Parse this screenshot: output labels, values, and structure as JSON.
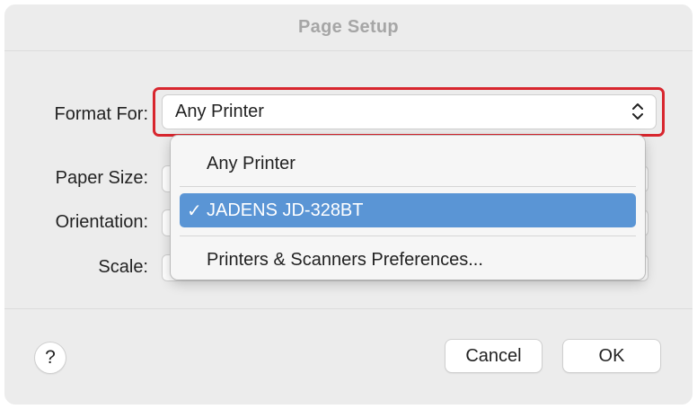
{
  "dialog": {
    "title": "Page Setup",
    "help_label": "?",
    "cancel_label": "Cancel",
    "ok_label": "OK"
  },
  "format_for": {
    "label": "Format For:",
    "selected_value": "Any Printer",
    "highlight_color": "#d8262e"
  },
  "paper_size": {
    "label": "Paper Size:"
  },
  "orientation": {
    "label": "Orientation:"
  },
  "scale": {
    "label": "Scale:"
  },
  "dropdown": {
    "items": [
      {
        "label": "Any Printer",
        "selected": false
      },
      {
        "label": "JADENS JD-328BT",
        "selected": true
      },
      {
        "label": "Printers & Scanners Preferences...",
        "selected": false
      }
    ],
    "check_mark": "✓",
    "selected_color": "#5a95d5"
  }
}
